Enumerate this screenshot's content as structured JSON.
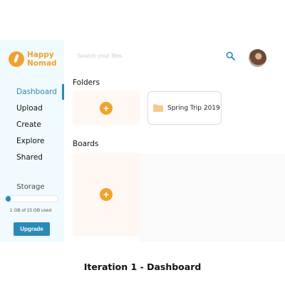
{
  "brand": {
    "line1": "Happy",
    "line2": "Nomad"
  },
  "nav": {
    "items": [
      {
        "label": "Dashboard"
      },
      {
        "label": "Upload"
      },
      {
        "label": "Create"
      },
      {
        "label": "Explore"
      },
      {
        "label": "Shared"
      }
    ],
    "active": "Dashboard"
  },
  "storage": {
    "label": "Storage",
    "used_text": "1 GB of 15 GB used",
    "used_fraction": 0.067,
    "upgrade_label": "Upgrade"
  },
  "header": {
    "search_placeholder": "Search your files"
  },
  "folders": {
    "title": "Folders",
    "items": [
      {
        "name": "Spring Trip 2019"
      }
    ]
  },
  "boards": {
    "title": "Boards"
  },
  "caption": "Iteration 1 - Dashboard",
  "colors": {
    "accent": "#2a89b6",
    "brand": "#f2a22c",
    "sidebar_bg": "#f1fbff"
  },
  "icons": [
    "logo-icon",
    "search-icon",
    "avatar",
    "add-icon",
    "folder-icon"
  ]
}
